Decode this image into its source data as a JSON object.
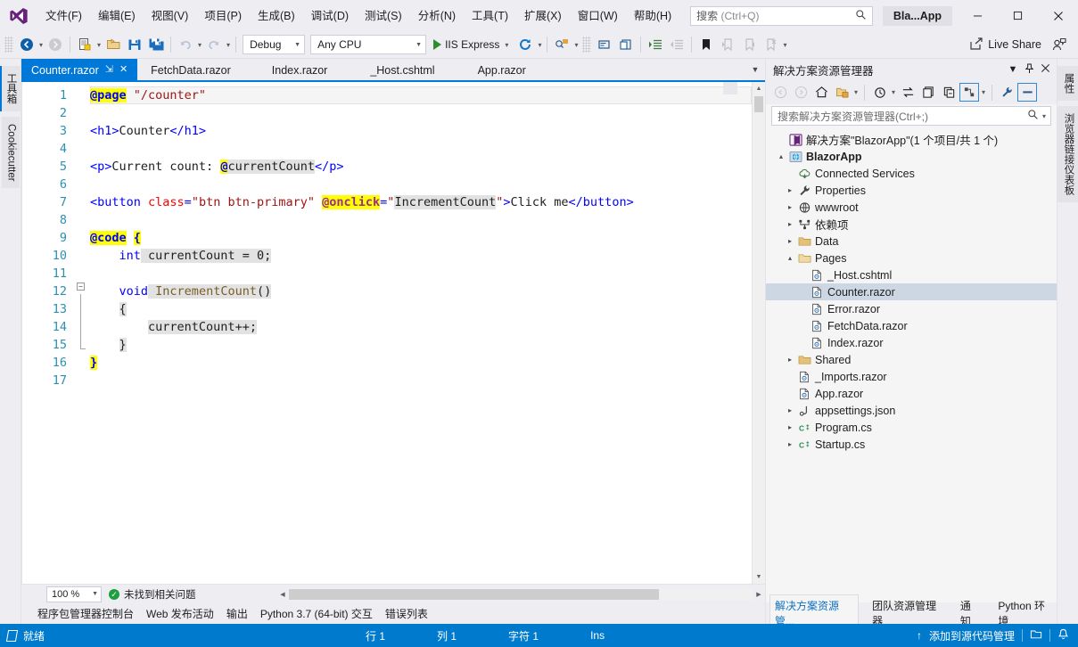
{
  "window": {
    "project_chip": "Bla...App",
    "minimize": "–",
    "maximize": "☐",
    "close": "✕"
  },
  "menubar": {
    "logo": "visual-studio-logo",
    "items": [
      {
        "label": "文件(F)"
      },
      {
        "label": "编辑(E)"
      },
      {
        "label": "视图(V)"
      },
      {
        "label": "项目(P)"
      },
      {
        "label": "生成(B)"
      },
      {
        "label": "调试(D)"
      },
      {
        "label": "测试(S)"
      },
      {
        "label": "分析(N)"
      },
      {
        "label": "工具(T)"
      },
      {
        "label": "扩展(X)"
      },
      {
        "label": "窗口(W)"
      },
      {
        "label": "帮助(H)"
      }
    ],
    "search": {
      "placeholder_main": "搜索 ",
      "placeholder_hint": "(Ctrl+Q)",
      "icon": "search-icon"
    }
  },
  "toolbar": {
    "back": "navigate-back-icon",
    "forward": "navigate-forward-icon",
    "new_item": "new-item-icon",
    "open_file": "open-file-icon",
    "save": "save-icon",
    "save_all": "save-all-icon",
    "undo": "undo-icon",
    "redo": "redo-icon",
    "configuration": "Debug",
    "platform": "Any CPU",
    "run_target": "IIS Express",
    "refresh": "hot-reload-icon",
    "find_in_window": "find-icon",
    "comment": "comment-icon",
    "uncomment": "uncomment-icon",
    "indent": "increase-indent-icon",
    "outdent": "decrease-indent-icon",
    "bookmark": "bookmark-icon",
    "prev_bookmark": "previous-bookmark-icon",
    "next_bookmark": "next-bookmark-icon",
    "clear_bookmark": "clear-bookmark-icon",
    "live_share": "Live Share",
    "live_share_icon": "share-icon",
    "feedback_icon": "feedback-person-icon"
  },
  "left_rail": {
    "tabs": [
      {
        "label": "工具箱",
        "name": "toolbox"
      },
      {
        "label": "Cookiecutter",
        "name": "cookiecutter"
      }
    ]
  },
  "right_rail": {
    "tabs": [
      {
        "label": "属性",
        "name": "properties"
      },
      {
        "label": "浏览器链接仪表板",
        "name": "browser-link-dashboard"
      }
    ]
  },
  "doc_tabs": {
    "overflow_icon": "chevron-down-icon",
    "items": [
      {
        "label": "Counter.razor",
        "active": true,
        "pin": "⇲",
        "close": "✕"
      },
      {
        "label": "FetchData.razor",
        "active": false
      },
      {
        "label": "Index.razor",
        "active": false
      },
      {
        "label": "_Host.cshtml",
        "active": false
      },
      {
        "label": "App.razor",
        "active": false
      }
    ]
  },
  "editor": {
    "line_numbers": [
      "1",
      "2",
      "3",
      "4",
      "5",
      "6",
      "7",
      "8",
      "9",
      "10",
      "11",
      "12",
      "13",
      "14",
      "15",
      "16",
      "17"
    ],
    "code_text": [
      "@page \"/counter\"",
      "",
      "<h1>Counter</h1>",
      "",
      "<p>Current count: @currentCount</p>",
      "",
      "<button class=\"btn btn-primary\" @onclick=\"IncrementCount\">Click me</button>",
      "",
      "@code {",
      "    int currentCount = 0;",
      "",
      "    void IncrementCount()",
      "    {",
      "        currentCount++;",
      "    }",
      "}",
      ""
    ],
    "zoom_level": "100 %",
    "issue_status": "未找到相关问题",
    "issue_icon": "check-circle-icon"
  },
  "bottom_tabs": {
    "items": [
      {
        "label": "程序包管理器控制台"
      },
      {
        "label": "Web 发布活动"
      },
      {
        "label": "输出"
      },
      {
        "label": "Python 3.7 (64-bit) 交互"
      },
      {
        "label": "错误列表"
      }
    ]
  },
  "solution_explorer": {
    "title": "解决方案资源管理器",
    "dropdown_icon": "chevron-down-icon",
    "pin_icon": "pin-icon",
    "close_icon": "close-icon",
    "toolbar": {
      "back": "back-icon",
      "forward": "forward-icon",
      "home": "home-icon",
      "pending_changes": "pending-changes-icon",
      "history": "history-icon",
      "sync_with_active": "sync-with-active-document-icon",
      "refresh": "refresh-icon",
      "collapse_all": "collapse-all-icon",
      "show_all_files": "show-all-files-icon",
      "properties": "properties-wrench-icon",
      "preview": "preview-selected-items-icon"
    },
    "search_placeholder": "搜索解决方案资源管理器(Ctrl+;)",
    "search_icon": "search-icon",
    "tree": [
      {
        "label": "解决方案\"BlazorApp\"(1 个项目/共 1 个)",
        "indent": 0,
        "expander": "",
        "icon": "solution-icon",
        "bold": false,
        "selected": false
      },
      {
        "label": "BlazorApp",
        "indent": 0,
        "expander": "▴",
        "icon": "web-project-icon",
        "bold": true,
        "selected": false
      },
      {
        "label": "Connected Services",
        "indent": 1,
        "expander": "",
        "icon": "connected-services-icon",
        "bold": false,
        "selected": false
      },
      {
        "label": "Properties",
        "indent": 1,
        "expander": "▸",
        "icon": "wrench-icon",
        "bold": false,
        "selected": false
      },
      {
        "label": "wwwroot",
        "indent": 1,
        "expander": "▸",
        "icon": "globe-icon",
        "bold": false,
        "selected": false
      },
      {
        "label": "依赖项",
        "indent": 1,
        "expander": "▸",
        "icon": "dependencies-icon",
        "bold": false,
        "selected": false
      },
      {
        "label": "Data",
        "indent": 1,
        "expander": "▸",
        "icon": "folder-icon",
        "bold": false,
        "selected": false
      },
      {
        "label": "Pages",
        "indent": 1,
        "expander": "▴",
        "icon": "folder-open-icon",
        "bold": false,
        "selected": false
      },
      {
        "label": "_Host.cshtml",
        "indent": 2,
        "expander": "",
        "icon": "razor-file-icon",
        "bold": false,
        "selected": false
      },
      {
        "label": "Counter.razor",
        "indent": 2,
        "expander": "",
        "icon": "razor-file-icon",
        "bold": false,
        "selected": true
      },
      {
        "label": "Error.razor",
        "indent": 2,
        "expander": "",
        "icon": "razor-file-icon",
        "bold": false,
        "selected": false
      },
      {
        "label": "FetchData.razor",
        "indent": 2,
        "expander": "",
        "icon": "razor-file-icon",
        "bold": false,
        "selected": false
      },
      {
        "label": "Index.razor",
        "indent": 2,
        "expander": "",
        "icon": "razor-file-icon",
        "bold": false,
        "selected": false
      },
      {
        "label": "Shared",
        "indent": 1,
        "expander": "▸",
        "icon": "folder-icon",
        "bold": false,
        "selected": false
      },
      {
        "label": "_Imports.razor",
        "indent": 2,
        "expander": "",
        "icon": "razor-file-icon",
        "bold": false,
        "selected": false
      },
      {
        "label": "App.razor",
        "indent": 2,
        "expander": "",
        "icon": "razor-file-icon",
        "bold": false,
        "selected": false
      },
      {
        "label": "appsettings.json",
        "indent": 1,
        "expander": "▸",
        "icon": "json-file-icon",
        "bold": false,
        "selected": false
      },
      {
        "label": "Program.cs",
        "indent": 1,
        "expander": "▸",
        "icon": "csharp-file-icon",
        "bold": false,
        "selected": false
      },
      {
        "label": "Startup.cs",
        "indent": 1,
        "expander": "▸",
        "icon": "csharp-file-icon",
        "bold": false,
        "selected": false
      }
    ],
    "foot_tabs": [
      {
        "label": "解决方案资源管...",
        "selected": true
      },
      {
        "label": "团队资源管理器",
        "selected": false
      },
      {
        "label": "通知",
        "selected": false
      },
      {
        "label": "Python 环境",
        "selected": false
      }
    ]
  },
  "statusbar": {
    "state": "就绪",
    "state_icon": "ready-flag-icon",
    "line": "行 1",
    "column": "列 1",
    "char": "字符 1",
    "insert_mode": "Ins",
    "source_control": "添加到源代码管理",
    "upload_icon": "up-arrow-icon",
    "repo_icon": "repository-icon",
    "bell_icon": "notification-icon"
  },
  "colors": {
    "accent": "#007acc",
    "tab_active": "#0078d7",
    "menu_bg": "#eeeef2",
    "editor_bg": "#ffffff",
    "tree_selected": "#cdd7e4"
  }
}
